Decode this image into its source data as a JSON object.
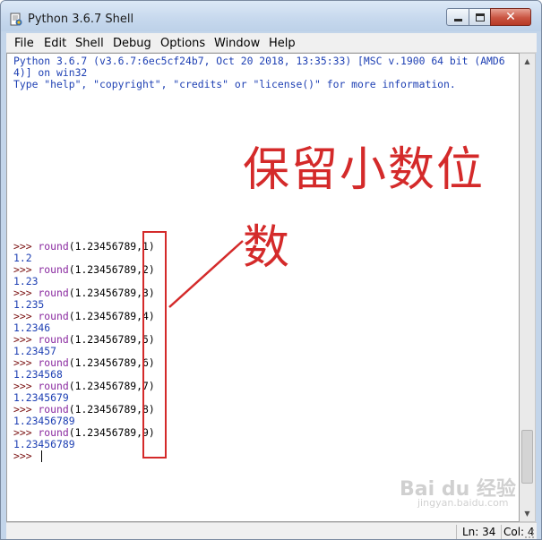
{
  "window": {
    "title": "Python 3.6.7 Shell",
    "close_glyph": "✕"
  },
  "menu": [
    "File",
    "Edit",
    "Shell",
    "Debug",
    "Options",
    "Window",
    "Help"
  ],
  "banner": [
    "Python 3.6.7 (v3.6.7:6ec5cf24b7, Oct 20 2018, 13:35:33) [MSC v.1900 64 bit (AMD6",
    "4)] on win32",
    "Type \"help\", \"copyright\", \"credits\" or \"license()\" for more information."
  ],
  "session": [
    {
      "prompt": ">>> ",
      "func": "round",
      "args": "(1.23456789,1)",
      "output": "1.2"
    },
    {
      "prompt": ">>> ",
      "func": "round",
      "args": "(1.23456789,2)",
      "output": "1.23"
    },
    {
      "prompt": ">>> ",
      "func": "round",
      "args": "(1.23456789,3)",
      "output": "1.235"
    },
    {
      "prompt": ">>> ",
      "func": "round",
      "args": "(1.23456789,4)",
      "output": "1.2346"
    },
    {
      "prompt": ">>> ",
      "func": "round",
      "args": "(1.23456789,5)",
      "output": "1.23457"
    },
    {
      "prompt": ">>> ",
      "func": "round",
      "args": "(1.23456789,6)",
      "output": "1.234568"
    },
    {
      "prompt": ">>> ",
      "func": "round",
      "args": "(1.23456789,7)",
      "output": "1.2345679"
    },
    {
      "prompt": ">>> ",
      "func": "round",
      "args": "(1.23456789,8)",
      "output": "1.23456789"
    },
    {
      "prompt": ">>> ",
      "func": "round",
      "args": "(1.23456789,9)",
      "output": "1.23456789"
    }
  ],
  "last_prompt": ">>> ",
  "annotation": {
    "line1": "保留小数位",
    "line2": "数",
    "color": "#d42a2a"
  },
  "status": {
    "line": "Ln: 34",
    "col": "Col: 4"
  },
  "watermark": {
    "main": "Bai du 经验",
    "sub": "jingyan.baidu.com"
  }
}
